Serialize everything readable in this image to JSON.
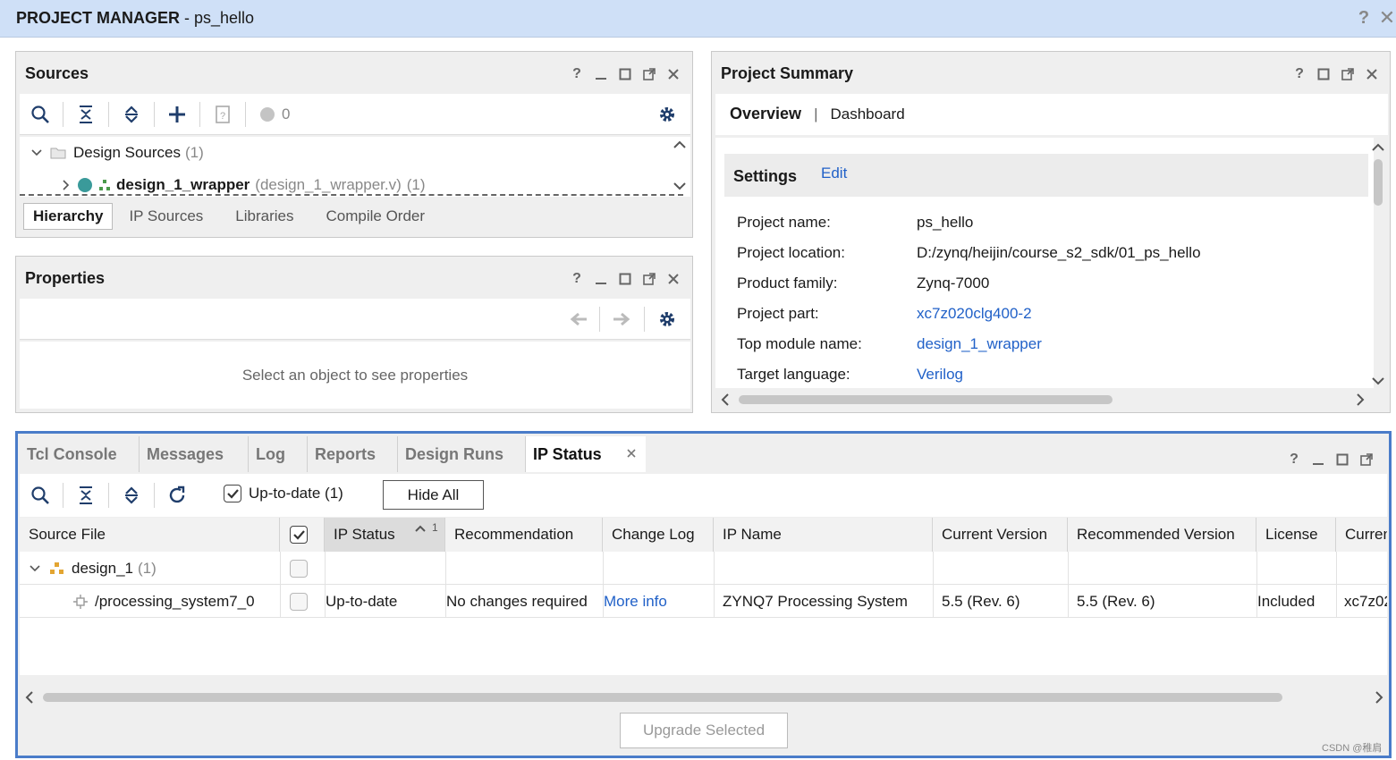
{
  "header": {
    "title_bold": "PROJECT MANAGER",
    "title_sep": " - ",
    "project": "ps_hello"
  },
  "sources": {
    "title": "Sources",
    "toolbar": {
      "count": "0"
    },
    "tree": {
      "design_sources_label": "Design Sources",
      "design_sources_count": "(1)",
      "wrapper_name": "design_1_wrapper",
      "wrapper_file": "(design_1_wrapper.v)",
      "wrapper_count": "(1)"
    },
    "tabs": [
      "Hierarchy",
      "IP Sources",
      "Libraries",
      "Compile Order"
    ]
  },
  "properties": {
    "title": "Properties",
    "empty_message": "Select an object to see properties"
  },
  "summary": {
    "title": "Project Summary",
    "tabs": {
      "overview": "Overview",
      "sep": "|",
      "dashboard": "Dashboard"
    },
    "settings_title": "Settings",
    "edit_label": "Edit",
    "rows": [
      {
        "label": "Project name:",
        "value": "ps_hello"
      },
      {
        "label": "Project location:",
        "value": "D:/zynq/heijin/course_s2_sdk/01_ps_hello"
      },
      {
        "label": "Product family:",
        "value": "Zynq-7000"
      },
      {
        "label": "Project part:",
        "value": "xc7z020clg400-2"
      },
      {
        "label": "Top module name:",
        "value": "design_1_wrapper"
      },
      {
        "label": "Target language:",
        "value": "Verilog"
      }
    ]
  },
  "bottom": {
    "tabs": [
      "Tcl Console",
      "Messages",
      "Log",
      "Reports",
      "Design Runs",
      "IP Status"
    ],
    "toolbar": {
      "uptodate_label": "Up-to-date (1)",
      "hide_all": "Hide All"
    },
    "columns": [
      "Source File",
      "IP Status",
      "Recommendation",
      "Change Log",
      "IP Name",
      "Current Version",
      "Recommended Version",
      "License",
      "Curren"
    ],
    "sort_indicator": "1",
    "group_row": {
      "name": "design_1",
      "count": "(1)"
    },
    "ip_row": {
      "source": "/processing_system7_0",
      "status": "Up-to-date",
      "recommendation": "No changes required",
      "change_log": "More info",
      "ip_name": "ZYNQ7 Processing System",
      "current_version": "5.5 (Rev. 6)",
      "recommended_version": "5.5 (Rev. 6)",
      "license": "Included",
      "current_part": "xc7z02"
    },
    "upgrade_button": "Upgrade Selected"
  },
  "watermark": "CSDN @稚肩",
  "colors": {
    "header_bg": "#cfe0f7",
    "link": "#2161c8",
    "focus_border": "#4a7cc9",
    "status_dot": "#3a9a9a"
  }
}
